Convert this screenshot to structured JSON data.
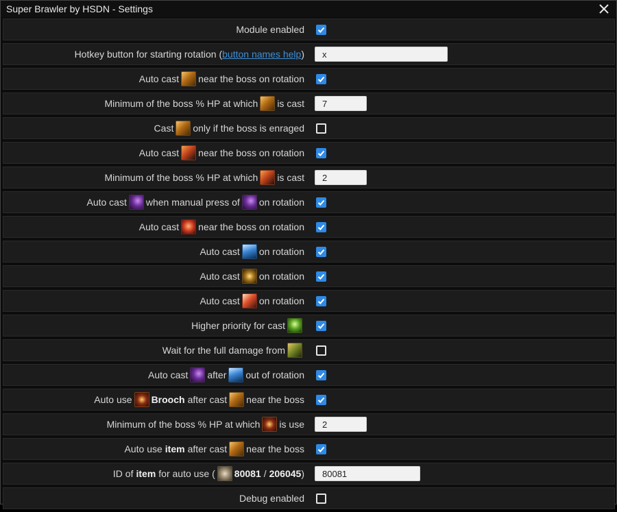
{
  "window": {
    "title": "Super Brawler by HSDN - Settings"
  },
  "settings": {
    "module_enabled": {
      "label": "Module enabled",
      "checked": true
    },
    "hotkey": {
      "label_before": "Hotkey button for starting rotation (",
      "link": "button names help",
      "label_after": ")",
      "value": "x"
    },
    "r1": {
      "a": "Auto cast",
      "b": "near the boss on rotation",
      "checked": true
    },
    "r2": {
      "a": "Minimum of the boss % HP at which",
      "b": "is cast",
      "value": "7"
    },
    "r3": {
      "a": "Cast",
      "b": "only if the boss is enraged",
      "checked": false
    },
    "r4": {
      "a": "Auto cast",
      "b": "near the boss on rotation",
      "checked": true
    },
    "r5": {
      "a": "Minimum of the boss % HP at which",
      "b": "is cast",
      "value": "2"
    },
    "r6": {
      "a": "Auto cast",
      "b": "when manual press of",
      "c": "on rotation",
      "checked": true
    },
    "r7": {
      "a": "Auto cast",
      "b": "near the boss on rotation",
      "checked": true
    },
    "r8": {
      "a": "Auto cast",
      "b": "on rotation",
      "checked": true
    },
    "r9": {
      "a": "Auto cast",
      "b": "on rotation",
      "checked": true
    },
    "r10": {
      "a": "Auto cast",
      "b": "on rotation",
      "checked": true
    },
    "r11": {
      "a": "Higher priority for cast",
      "checked": true
    },
    "r12": {
      "a": "Wait for the full damage from",
      "checked": false
    },
    "r13": {
      "a": "Auto cast",
      "b": "after",
      "c": "out of rotation",
      "checked": true
    },
    "r14": {
      "a": "Auto use",
      "bold": "Brooch",
      "b": "after cast",
      "c": "near the boss",
      "checked": true
    },
    "r15": {
      "a": "Minimum of the boss % HP at which",
      "b": "is use",
      "value": "2"
    },
    "r16": {
      "a": "Auto use",
      "bold": "item",
      "b": "after cast",
      "c": "near the boss",
      "checked": true
    },
    "r17": {
      "a": "ID of",
      "bold": "item",
      "b": "for auto use (",
      "id1": "80081",
      "slash": "/",
      "id2": "206045",
      "close": ")",
      "value": "80081"
    },
    "debug": {
      "label": "Debug enabled",
      "checked": false
    }
  },
  "icons": {
    "skill_gold": "skill-gold-icon",
    "skill_fire": "skill-fire-icon",
    "skill_purple": "skill-purple-icon",
    "skill_red": "skill-red-icon",
    "skill_blue": "skill-blue-icon",
    "skill_gear": "skill-gear-icon",
    "skill_red_claw": "skill-red-claw-icon",
    "skill_green": "skill-green-icon",
    "skill_olive": "skill-olive-icon",
    "brooch": "brooch-icon",
    "item": "item-icon"
  },
  "colors": {
    "checkbox_on": "#2e8ae6",
    "link": "#3d8fd8",
    "row_bg": "#1c1c1c"
  }
}
